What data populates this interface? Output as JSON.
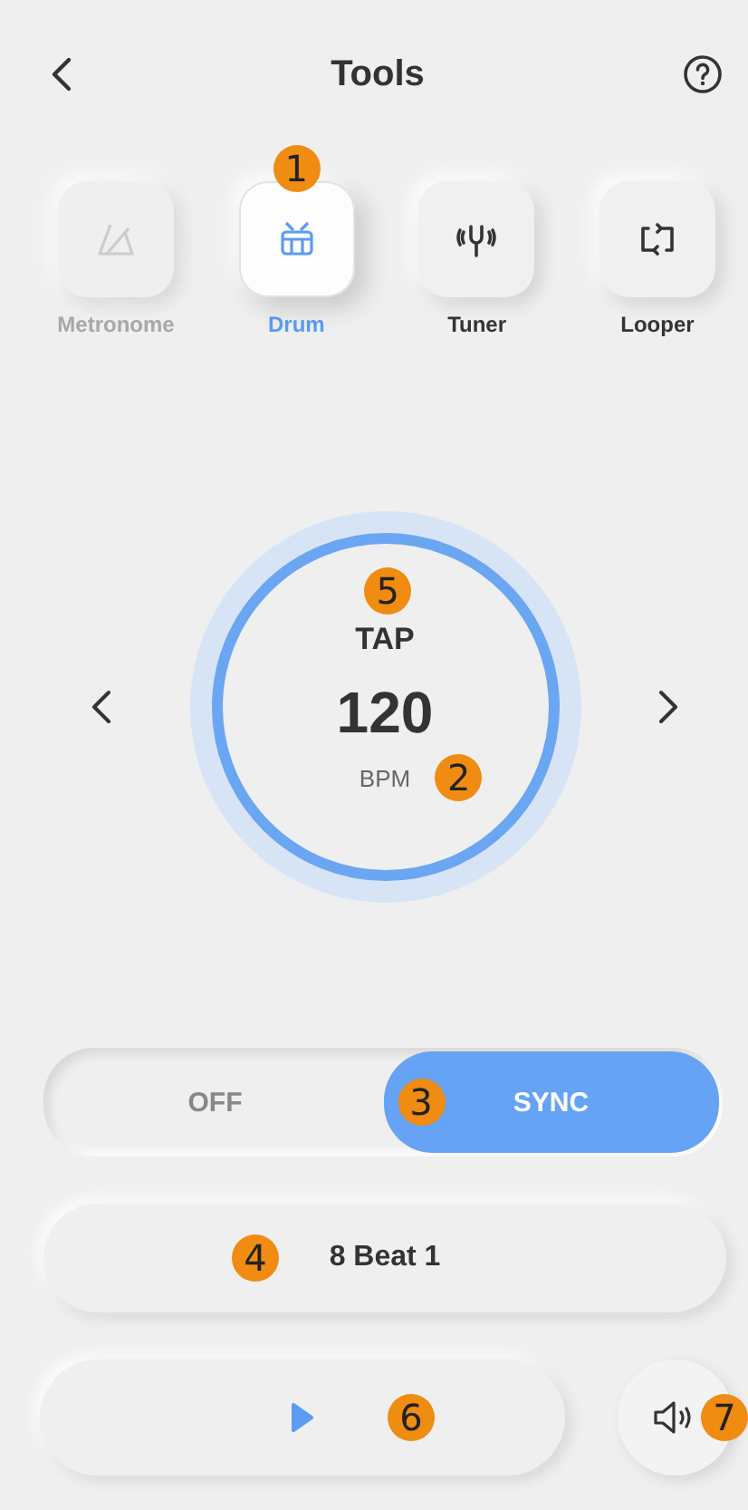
{
  "header": {
    "title": "Tools"
  },
  "tools": [
    {
      "label": "Metronome",
      "kind": "metronome",
      "selected": false,
      "disabled": true
    },
    {
      "label": "Drum",
      "kind": "drum",
      "selected": true,
      "disabled": false,
      "callout": "1"
    },
    {
      "label": "Tuner",
      "kind": "tuner",
      "selected": false,
      "disabled": false
    },
    {
      "label": "Looper",
      "kind": "looper",
      "selected": false,
      "disabled": false
    }
  ],
  "tempo": {
    "tap": "TAP",
    "tap_callout": "5",
    "value": "120",
    "unit": "BPM",
    "unit_callout": "2"
  },
  "sync": {
    "options": [
      {
        "label": "OFF",
        "selected": false
      },
      {
        "label": "SYNC",
        "selected": true,
        "callout": "3"
      }
    ]
  },
  "pattern": {
    "label": "8 Beat 1",
    "callout": "4"
  },
  "play": {
    "callout": "6"
  },
  "sound": {
    "callout": "7"
  }
}
